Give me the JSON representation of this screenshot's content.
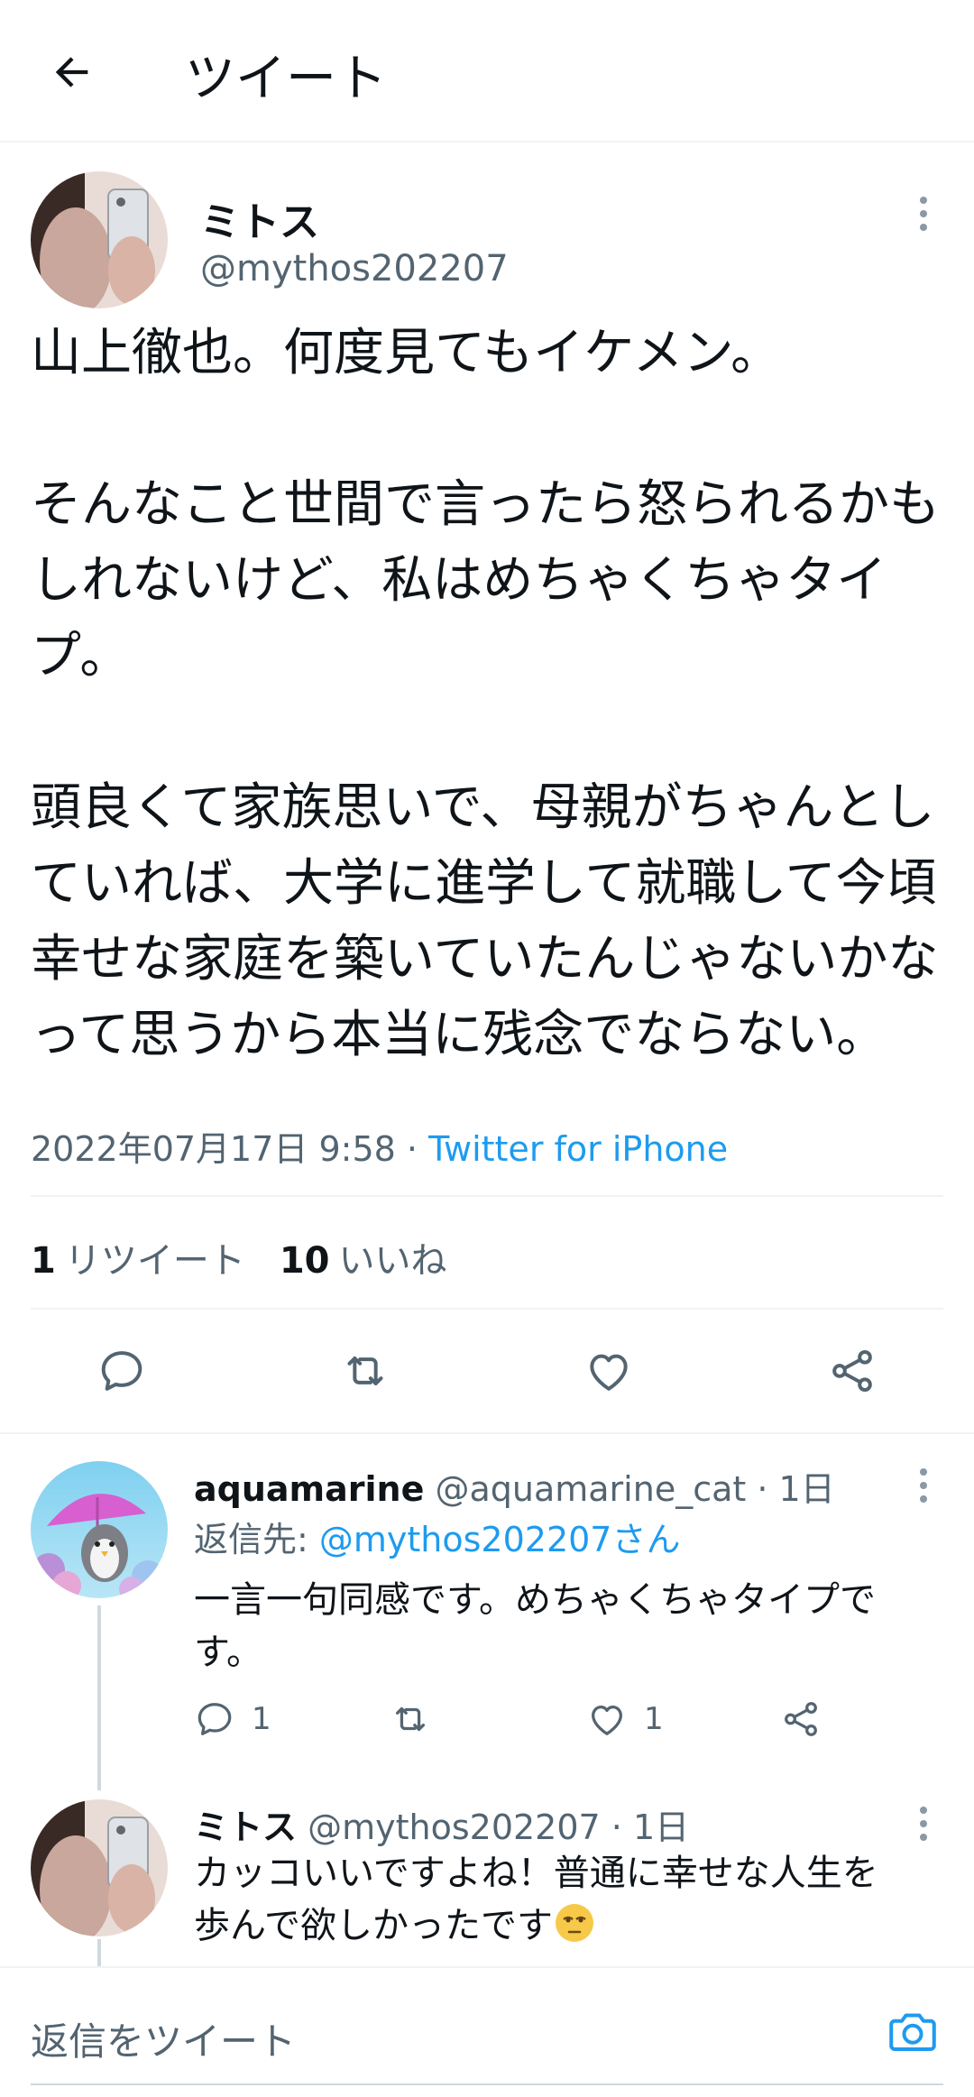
{
  "header": {
    "title": "ツイート"
  },
  "tweet": {
    "author_name": "ミトス",
    "author_handle": "@mythos202207",
    "text": "山上徹也。何度見てもイケメン。\n\nそんなこと世間で言ったら怒られるかもしれないけど、私はめちゃくちゃタイプ。\n\n頭良くて家族思いで、母親がちゃんとしていれば、大学に進学して就職して今頃幸せな家庭を築いていたんじゃないかなって思うから本当に残念でならない。",
    "timestamp": "2022年07月17日 9:58",
    "separator": " · ",
    "client": "Twitter for iPhone",
    "retweet_count": "1",
    "retweet_label": "リツイート",
    "like_count": "10",
    "like_label": "いいね"
  },
  "replies": [
    {
      "name": "aquamarine",
      "handle": "@aquamarine_cat",
      "time": " · 1日",
      "reply_to_label": "返信先: ",
      "reply_to_mention": "@mythos202207さん",
      "text": "一言一句同感です。めちゃくちゃタイプです。",
      "reply_count": "1",
      "like_count": "1"
    },
    {
      "name": "ミトス",
      "handle": "@mythos202207",
      "time": " · 1日",
      "text": "カッコいいですよね！普通に幸せな人生を歩んで欲しかったです"
    }
  ],
  "compose": {
    "placeholder": "返信をツイート"
  },
  "colors": {
    "accent": "#1d9bf0",
    "text": "#0f1419",
    "secondary": "#536471",
    "divider": "#eff3f4"
  },
  "icons": [
    "back-arrow-icon",
    "more-icon",
    "reply-icon",
    "retweet-icon",
    "like-icon",
    "share-icon",
    "camera-icon",
    "face-emoji-icon"
  ]
}
